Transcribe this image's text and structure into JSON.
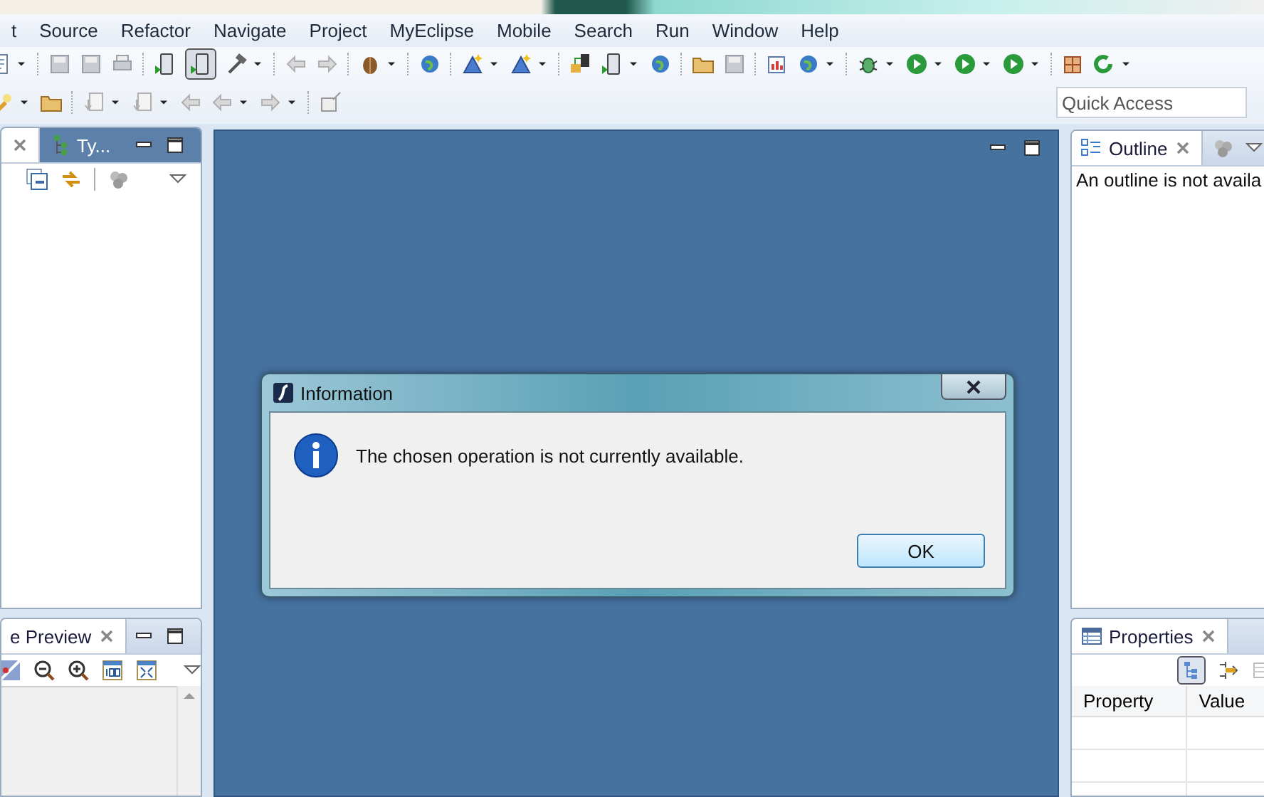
{
  "menu": {
    "items": [
      "t",
      "Source",
      "Refactor",
      "Navigate",
      "Project",
      "MyEclipse",
      "Mobile",
      "Search",
      "Run",
      "Window",
      "Help"
    ]
  },
  "toolbar": {
    "toggle_checked": true
  },
  "quick_access": {
    "placeholder": "Quick Access"
  },
  "left_top_view": {
    "tabs": [
      {
        "selected": true,
        "closable": true
      },
      {
        "label": "Ty...",
        "selected": false,
        "closable": false
      }
    ]
  },
  "left_bottom_view": {
    "tabs": [
      {
        "label": "e Preview",
        "selected": true,
        "closable": true
      }
    ]
  },
  "outline_view": {
    "tabs": [
      {
        "label": "Outline",
        "selected": true,
        "closable": true
      },
      {
        "selected": false,
        "closable": false
      }
    ],
    "message": "An outline is not availa"
  },
  "properties_view": {
    "tabs": [
      {
        "label": "Properties",
        "selected": true,
        "closable": true
      }
    ],
    "toggle_checked": true,
    "columns": [
      "Property",
      "Value"
    ]
  },
  "dialog": {
    "title": "Information",
    "message": "The chosen operation is not currently available.",
    "button": "OK"
  }
}
